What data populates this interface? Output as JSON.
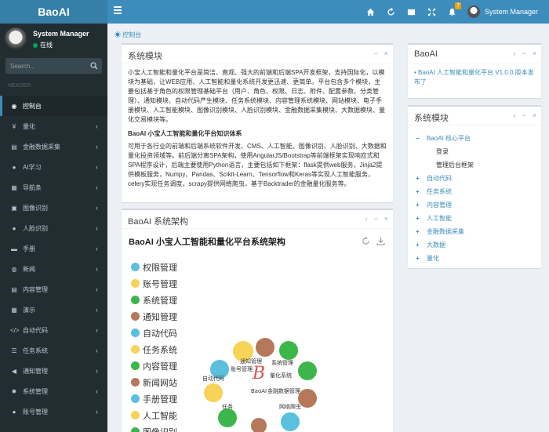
{
  "header": {
    "logo": "BaoAI",
    "notification_count": "7",
    "user_name": "System Manager"
  },
  "sidebar": {
    "user_name": "System Manager",
    "status": "在线",
    "search_placeholder": "Search...",
    "menu_header": "HEADER",
    "items": [
      {
        "label": "控制台",
        "icon": "dashboard-icon",
        "glyph": "◉",
        "active": true,
        "chevron": ""
      },
      {
        "label": "量化",
        "icon": "yen-icon",
        "glyph": "¥",
        "active": false,
        "chevron": "‹"
      },
      {
        "label": "金融数据采集",
        "icon": "database-icon",
        "glyph": "▤",
        "active": false,
        "chevron": "‹"
      },
      {
        "label": "AI学习",
        "icon": "ai-icon",
        "glyph": "●",
        "active": false,
        "chevron": "‹"
      },
      {
        "label": "导航条",
        "icon": "nav-icon",
        "glyph": "▦",
        "active": false,
        "chevron": "‹"
      },
      {
        "label": "图像识别",
        "icon": "image-icon",
        "glyph": "▣",
        "active": false,
        "chevron": "‹"
      },
      {
        "label": "人脸识别",
        "icon": "face-icon",
        "glyph": "●",
        "active": false,
        "chevron": "‹"
      },
      {
        "label": "手册",
        "icon": "book-icon",
        "glyph": "▬",
        "active": false,
        "chevron": "‹"
      },
      {
        "label": "新闻",
        "icon": "globe-icon",
        "glyph": "◍",
        "active": false,
        "chevron": "‹"
      },
      {
        "label": "内容管理",
        "icon": "content-icon",
        "glyph": "▤",
        "active": false,
        "chevron": "‹"
      },
      {
        "label": "演示",
        "icon": "demo-icon",
        "glyph": "▦",
        "active": false,
        "chevron": "‹"
      },
      {
        "label": "自动代码",
        "icon": "code-icon",
        "glyph": "</>",
        "active": false,
        "chevron": "‹"
      },
      {
        "label": "任务系统",
        "icon": "task-icon",
        "glyph": "☰",
        "active": false,
        "chevron": "‹"
      },
      {
        "label": "通知管理",
        "icon": "bullhorn-icon",
        "glyph": "◀",
        "active": false,
        "chevron": "‹"
      },
      {
        "label": "系统管理",
        "icon": "gear-icon",
        "glyph": "✹",
        "active": false,
        "chevron": "‹"
      },
      {
        "label": "账号管理",
        "icon": "user-icon",
        "glyph": "●",
        "active": false,
        "chevron": "‹"
      }
    ]
  },
  "breadcrumb": "控制台",
  "modules_box": {
    "title": "系统模块",
    "intro": "小宝人工智能和量化平台是简洁、直观、强大的前端和后端SPA开发框架，支持国际化，以模块为基础，让WEB应用、人工智能和量化系统开发更迅速、更简单。平台包含多个模块，主要包括基于角色的权限管理基础平台（用户、角色、权限、日志、附件、配置参数、分类管理）、通知模块、自动代码产生模块、任务系统模块、内容管理系统模块、网站模块、电子手册模块、人工智能模块、图像识别模块、人脸识别模块、金融数据采集模块、大数据模块、量化交易模块等。",
    "subtitle": "BaoAI 小宝人工智能和量化平台知识体系",
    "knowledge": "可用于各行业的前端和后端系统软件开发、CMS、人工智能、图像识别、人脸识别、大数据和量化投资领域等。前后端分离SPA架构，使用AngularJS/Bootstrap等前端框架实现响应式和SPA程序设计，后端主要使用Python语言，主要包括如下框架：flask提供web服务，Jinja2提供模板服务，Numpy、Pandas、Scikit-Learn、Tensorflow和Keras等实现人工智能服务，celery实现任务调度，scrapy提供网络爬虫，基于Backtrader的金融量化服务等。"
  },
  "arch_box": {
    "title": "BaoAI 系统架构",
    "chart_title": "BaoAI 小宝人工智能和量化平台系统架构",
    "legend": [
      {
        "label": "权限管理",
        "color": "#5bc0de"
      },
      {
        "label": "账号管理",
        "color": "#f7d358"
      },
      {
        "label": "系统管理",
        "color": "#3cb64a"
      },
      {
        "label": "通知管理",
        "color": "#b5785a"
      },
      {
        "label": "自动代码",
        "color": "#5bc0de"
      },
      {
        "label": "任务系统",
        "color": "#f7d358"
      },
      {
        "label": "内容管理",
        "color": "#3cb64a"
      },
      {
        "label": "新闻网站",
        "color": "#b5785a"
      },
      {
        "label": "手册管理",
        "color": "#5bc0de"
      },
      {
        "label": "人工智能",
        "color": "#f7d358"
      },
      {
        "label": "图像识别",
        "color": "#3cb64a"
      }
    ],
    "cloud_words": [
      "通知管理",
      "账号管理",
      "系统管理",
      "量化系统",
      "自动代码",
      "金融数据管理",
      "网络爬虫",
      "任务",
      "BaoAI"
    ]
  },
  "release_box": {
    "title": "BaoAI",
    "link": "BaoAI 人工智能和量化平台 V1.0.0 版本发布了"
  },
  "tree_box": {
    "title": "系统模块",
    "root": "BaoAI 核心平台",
    "children": [
      "登录",
      "管理后台框架"
    ],
    "nodes": [
      "自动代码",
      "任务系统",
      "内容管理",
      "人工智能",
      "金融数据采集",
      "大数据",
      "量化"
    ]
  },
  "colors": {
    "header": "#3c8dbc",
    "logo_bg": "#367fa9",
    "sidebar": "#222d32",
    "content_bg": "#ecf0f5",
    "link": "#3c8dbc"
  }
}
